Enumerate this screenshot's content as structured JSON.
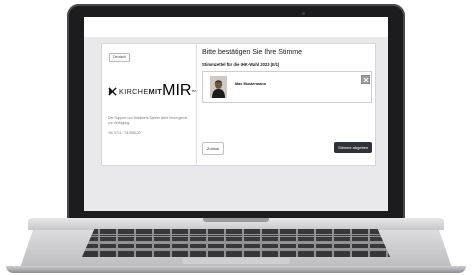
{
  "sidebar": {
    "language_button": "Deutsch",
    "logo": {
      "part1": "KIRCHE",
      "part2": "MIT",
      "part3": "MIR",
      "trademark": "TM"
    },
    "support_text": "Der Support von Wahlkreis Spieler steht Ihnen gerne zur Verfügung.",
    "phone": "Tel. 0711 / 781999-30"
  },
  "main": {
    "title": "Bitte bestätigen Sie Ihre Stimme",
    "ballot_label": "Stimmzettel für die IHK-Wahl 2023 (II/1)",
    "candidate": {
      "name": "Max Mustermann",
      "selected": true
    },
    "back_button": "Zurück",
    "submit_button": "Stimme abgeben"
  },
  "icons": {
    "logo_mark": "cross-x-logo-icon",
    "avatar": "candidate-photo",
    "check": "checkmark-x-icon"
  },
  "colors": {
    "primary_button": "#2f3337",
    "screen_background": "#e9e9eb"
  }
}
